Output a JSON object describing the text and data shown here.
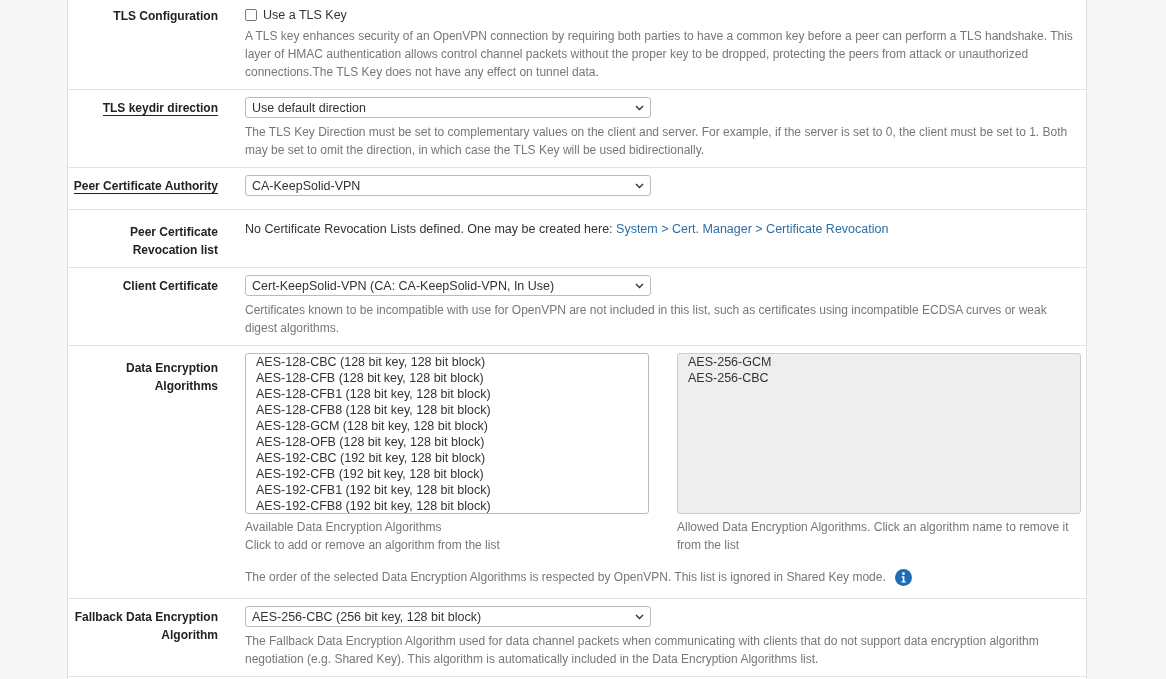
{
  "rows": [
    {
      "kind": "checkbox",
      "label": "TLS Configuration",
      "has_help": false,
      "checkbox": {
        "label": "Use a TLS Key",
        "checked": false
      },
      "help": "A TLS key enhances security of an OpenVPN connection by requiring both parties to have a common key before a peer can perform a TLS handshake. This layer of HMAC authentication allows control channel packets without the proper key to be dropped, protecting the peers from attack or unauthorized connections.The TLS Key does not have any effect on tunnel data."
    },
    {
      "kind": "select",
      "label": "TLS keydir direction",
      "has_help": true,
      "value": "Use default direction",
      "help": "The TLS Key Direction must be set to complementary values on the client and server. For example, if the server is set to 0, the client must be set to 1. Both may be set to omit the direction, in which case the TLS Key will be used bidirectionally."
    },
    {
      "kind": "select",
      "label": "Peer Certificate Authority",
      "has_help": true,
      "value": "CA-KeepSolid-VPN"
    },
    {
      "kind": "text_link",
      "label": "Peer Certificate Revocation list",
      "has_help": false,
      "text": "No Certificate Revocation Lists defined. One may be created here:",
      "link": "System > Cert. Manager > Certificate Revocation"
    },
    {
      "kind": "select",
      "label": "Client Certificate",
      "has_help": false,
      "value": "Cert-KeepSolid-VPN (CA: CA-KeepSolid-VPN, In Use)",
      "help": "Certificates known to be incompatible with use for OpenVPN are not included in this list, such as certificates using incompatible ECDSA curves or weak digest algorithms."
    },
    {
      "kind": "dual_list",
      "label": "Data Encryption Algorithms",
      "has_help": false,
      "available": {
        "disabled": false,
        "items": [
          "AES-128-CBC (128 bit key, 128 bit block)",
          "AES-128-CFB (128 bit key, 128 bit block)",
          "AES-128-CFB1 (128 bit key, 128 bit block)",
          "AES-128-CFB8 (128 bit key, 128 bit block)",
          "AES-128-GCM (128 bit key, 128 bit block)",
          "AES-128-OFB (128 bit key, 128 bit block)",
          "AES-192-CBC (192 bit key, 128 bit block)",
          "AES-192-CFB (192 bit key, 128 bit block)",
          "AES-192-CFB1 (192 bit key, 128 bit block)",
          "AES-192-CFB8 (192 bit key, 128 bit block)"
        ],
        "help": [
          "Available Data Encryption Algorithms",
          "Click to add or remove an algorithm from the list"
        ]
      },
      "allowed": {
        "disabled": true,
        "items": [
          "AES-256-GCM",
          "AES-256-CBC"
        ],
        "help": [
          "Allowed Data Encryption Algorithms. Click an algorithm name to remove it from the list"
        ]
      },
      "note": "The order of the selected Data Encryption Algorithms is respected by OpenVPN. This list is ignored in Shared Key mode."
    },
    {
      "kind": "select",
      "label": "Fallback Data Encryption Algorithm",
      "has_help": false,
      "value": "AES-256-CBC (256 bit key, 128 bit block)",
      "help": "The Fallback Data Encryption Algorithm used for data channel packets when communicating with clients that do not support data encryption algorithm negotiation (e.g. Shared Key). This algorithm is automatically included in the Data Encryption Algorithms list."
    }
  ]
}
